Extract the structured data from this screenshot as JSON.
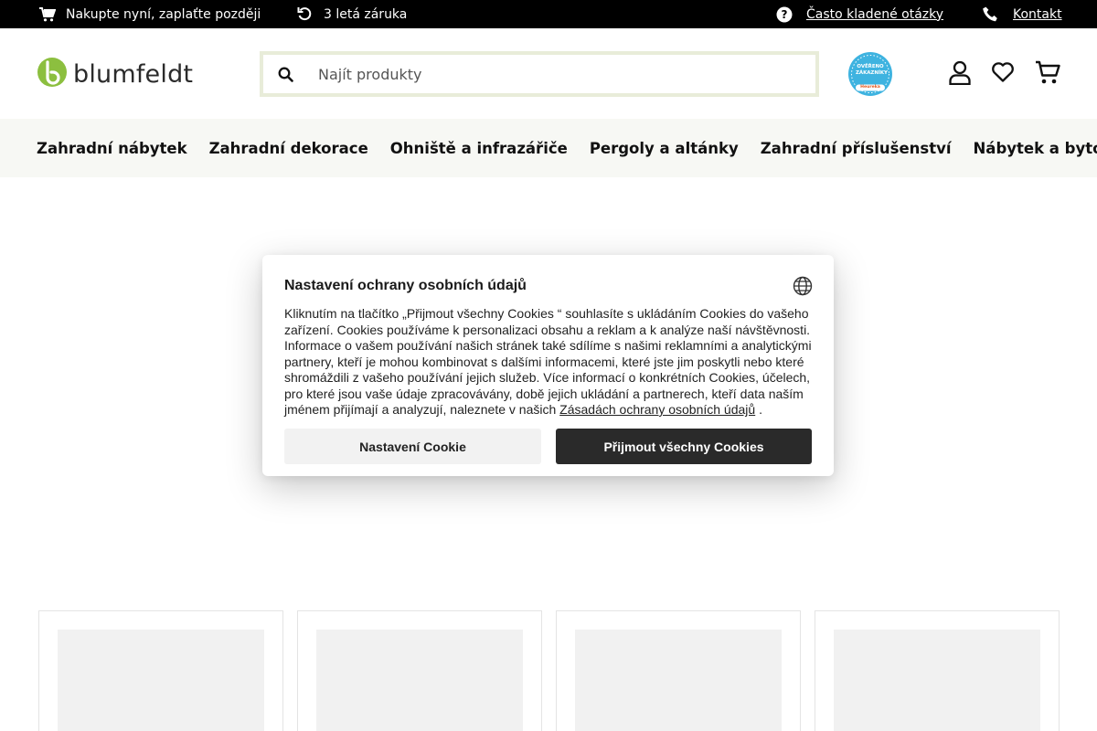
{
  "topbar": {
    "pay_later": "Nakupte nyní, zaplaťte později",
    "warranty": "3 letá záruka",
    "faq": "Často kladené otázky",
    "contact": "Kontakt"
  },
  "header": {
    "logo_text": "blumfeldt",
    "search_placeholder": "Najít produkty",
    "badge_text": "OVĚŘENO ZÁKAZNÍKY",
    "badge_sub": "Heureka"
  },
  "nav": {
    "items": [
      "Zahradní nábytek",
      "Zahradní dekorace",
      "Ohniště a infrazářiče",
      "Pergoly a altánky",
      "Zahradní příslušenství",
      "Nábytek a bytové dop"
    ]
  },
  "cookie": {
    "title": "Nastavení ochrany osobních údajů",
    "body": "Kliknutím na tlačítko „Přijmout všechny Cookies “ souhlasíte s ukládáním Cookies do vašeho zařízení. Cookies používáme k personalizaci obsahu a reklam a k analýze naší návštěvnosti. Informace o vašem používání našich stránek také sdílíme s našimi reklamními a analytickými partnery, kteří je mohou kombinovat s dalšími informacemi, které jste jim poskytli nebo které shromáždili z vašeho používání jejich služeb. Více informací o konkrétních Cookies, účelech, pro které jsou vaše údaje zpracovávány, době jejich ukládání a partnerech, kteří data naším jménem přijímají a analyzují, naleznete v našich ",
    "link": "Zásadách ochrany osobních údajů",
    "after_link": " .",
    "settings_button": "Nastavení Cookie",
    "accept_button": "Přijmout všechny Cookies"
  },
  "colors": {
    "brand_green": "#8cbf3f",
    "topbar_bg": "#000000",
    "nav_bg": "#f7f8f4",
    "accept_bg": "#2a2a2a"
  },
  "icons": [
    "cart-icon",
    "undo-icon",
    "help-icon",
    "phone-icon",
    "search-icon",
    "user-icon",
    "heart-icon",
    "cart-icon",
    "globe-icon"
  ]
}
